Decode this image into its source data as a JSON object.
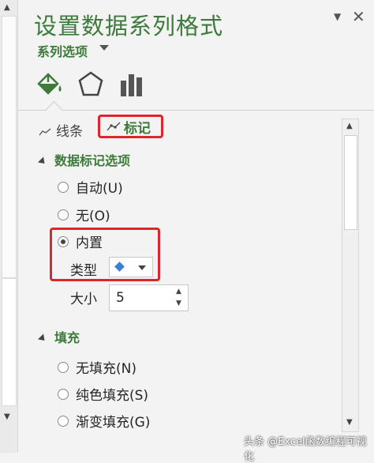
{
  "pane": {
    "title": "设置数据系列格式",
    "series_options_label": "系列选项",
    "close_glyph": "✕",
    "dropdown_glyph": "▼"
  },
  "icons": {
    "fill_line": "paint-bucket-icon",
    "effects": "pentagon-icon",
    "series_options": "bar-chart-icon"
  },
  "tabs": {
    "lines_label": "线条",
    "markers_label": "标记"
  },
  "marker_options": {
    "header": "数据标记选项",
    "options": [
      {
        "label": "自动(U)",
        "selected": false
      },
      {
        "label": "无(O)",
        "selected": false
      },
      {
        "label": "内置",
        "selected": true
      }
    ],
    "type_label": "类型",
    "type_value": "diamond",
    "size_label": "大小",
    "size_value": "5"
  },
  "fill": {
    "header": "填充",
    "options": [
      {
        "label": "无填充(N)",
        "selected": false
      },
      {
        "label": "纯色填充(S)",
        "selected": false
      },
      {
        "label": "渐变填充(G)",
        "selected": false
      }
    ]
  },
  "watermark": "头条 @Excel函数编程可视化",
  "colors": {
    "accent_green": "#3c7b3a",
    "highlight_red": "#e0242b",
    "marker_blue": "#3d7fd0"
  }
}
